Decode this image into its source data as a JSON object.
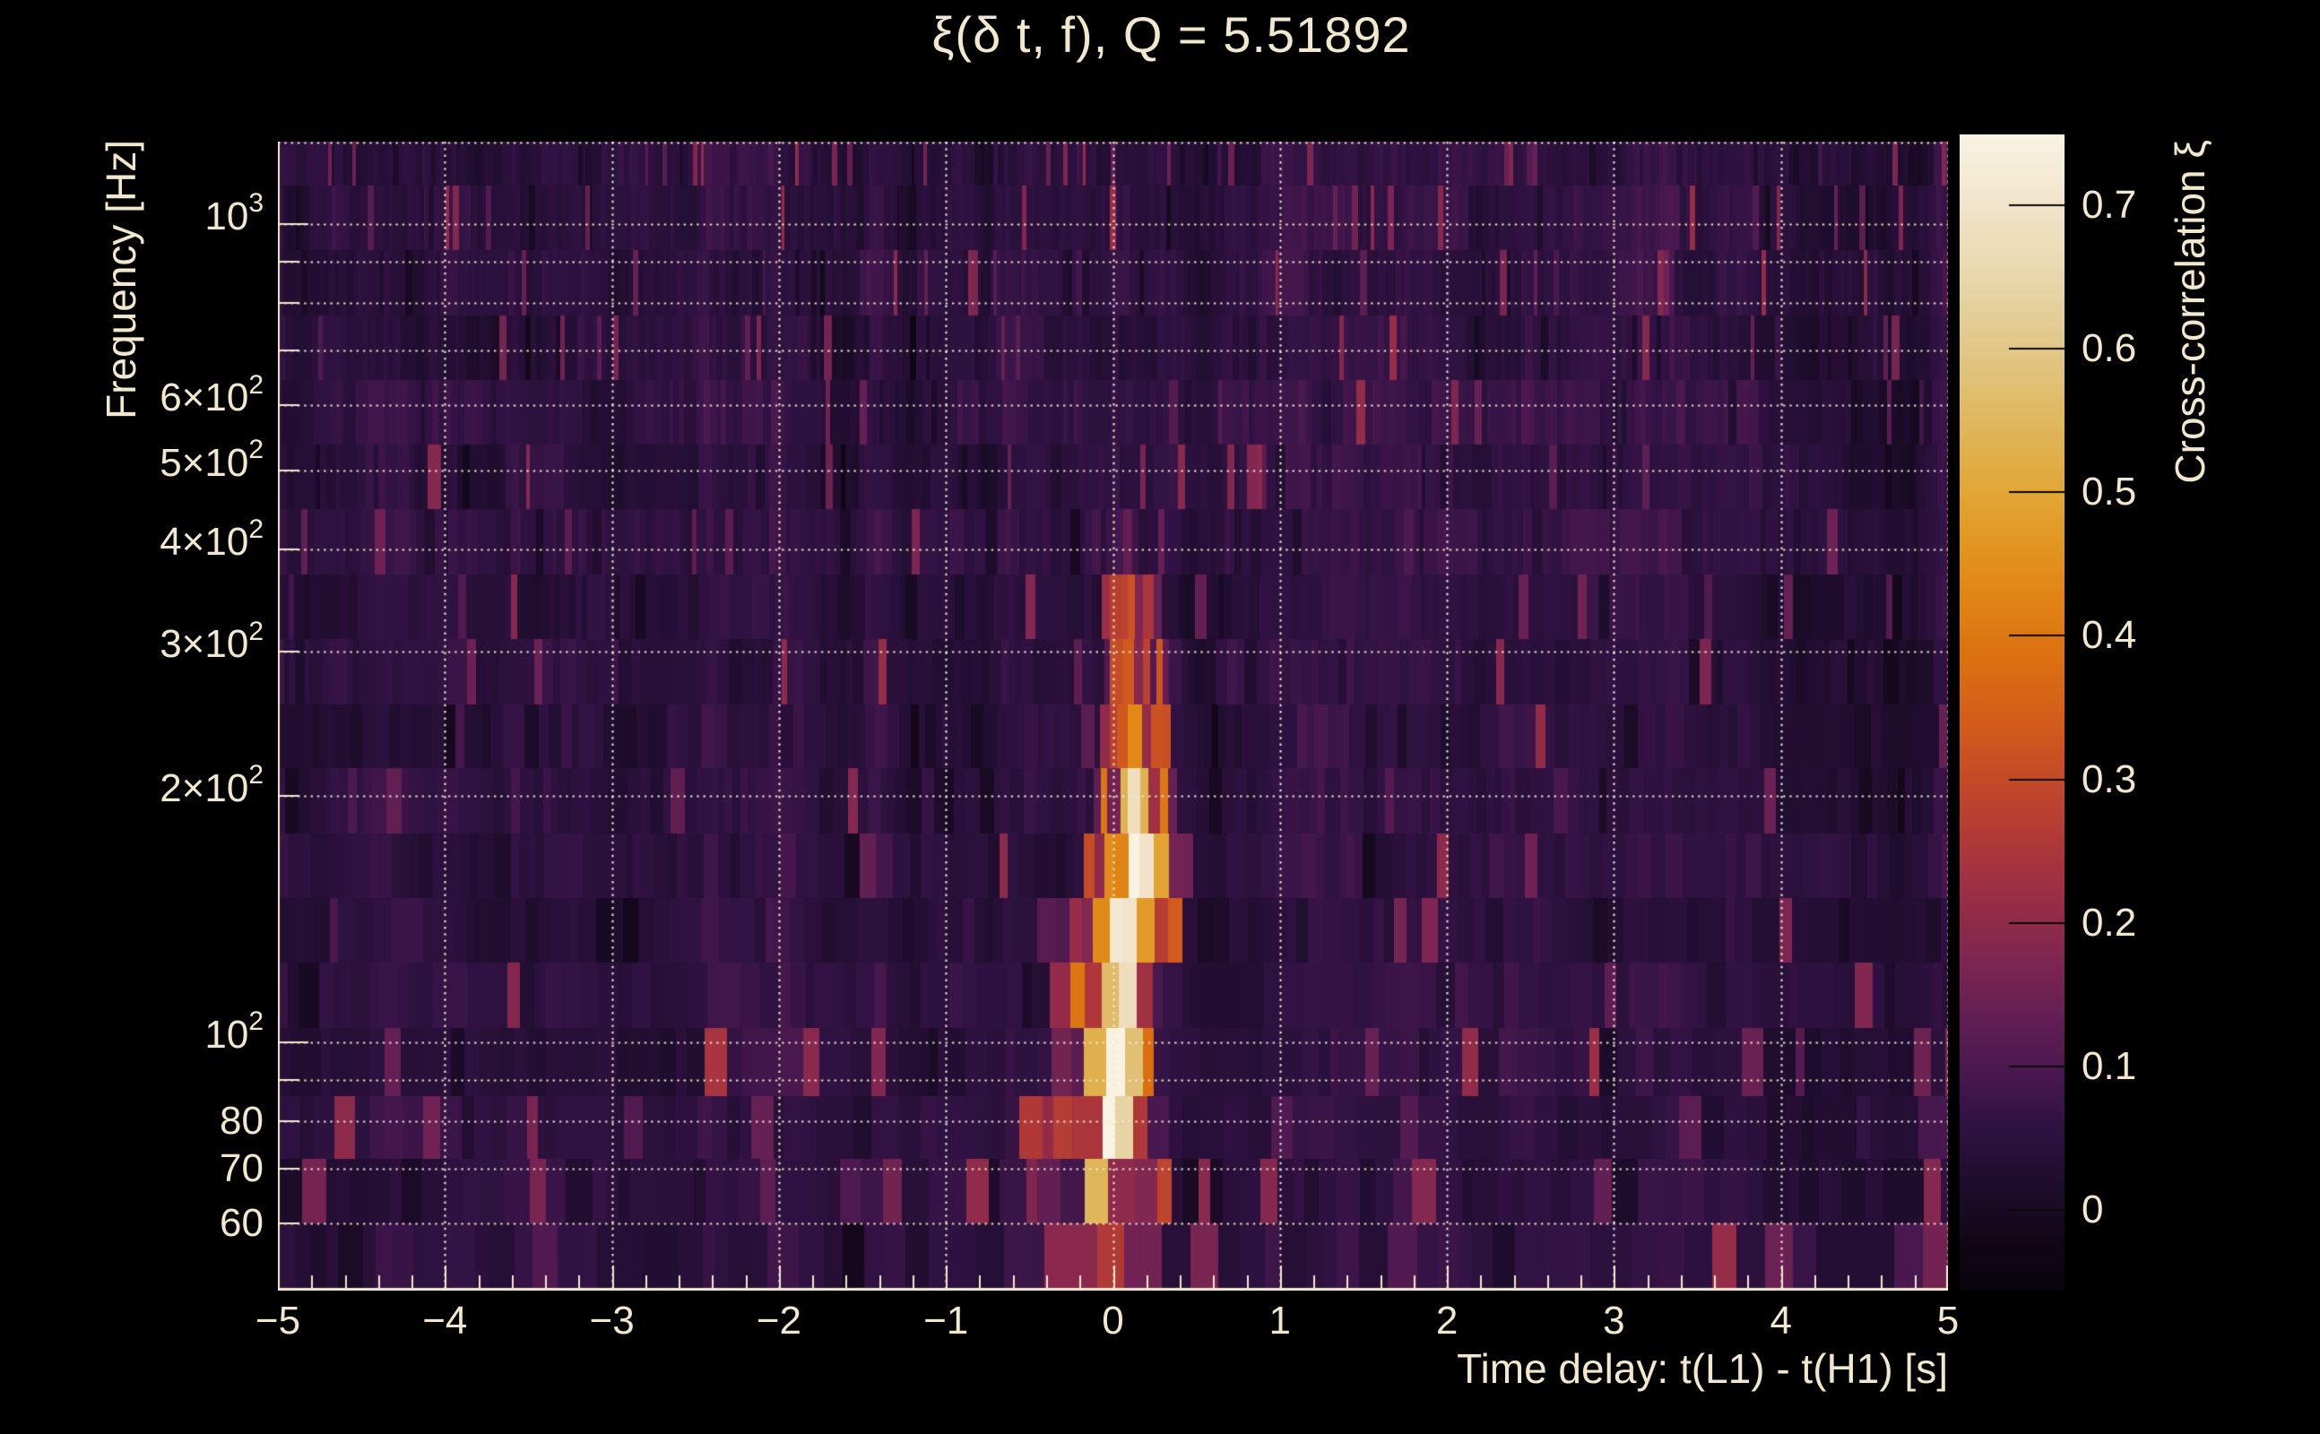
{
  "title": "ξ(δ t, f), Q = 5.51892",
  "colors": {
    "background": "#000000",
    "text": "#f2e8cd",
    "grid": "#f3ecd4",
    "axis_line": "#f2e8cd",
    "colorbar_tick": "#0a0a0a"
  },
  "chart_data": {
    "type": "heatmap",
    "title": "ξ(δ t, f), Q = 5.51892",
    "xlabel": "Time delay: t(L1) - t(H1) [s]",
    "ylabel": "Frequency [Hz]",
    "colorbar_label": "Cross-correlation ξ",
    "grid": true,
    "xlim": [
      -5,
      5
    ],
    "ylim": [
      49.7,
      1261
    ],
    "yscale": "log",
    "x_minor_step": 0.2,
    "x_ticks": [
      {
        "t": -5,
        "label": "−5"
      },
      {
        "t": -4,
        "label": "−4"
      },
      {
        "t": -3,
        "label": "−3"
      },
      {
        "t": -2,
        "label": "−2"
      },
      {
        "t": -1,
        "label": "−1"
      },
      {
        "t": 0,
        "label": "0"
      },
      {
        "t": 1,
        "label": "1"
      },
      {
        "t": 2,
        "label": "2"
      },
      {
        "t": 3,
        "label": "3"
      },
      {
        "t": 4,
        "label": "4"
      },
      {
        "t": 5,
        "label": "5"
      }
    ],
    "y_ticks": [
      {
        "f": 1000,
        "base": "10",
        "sup": "3"
      },
      {
        "f": 900
      },
      {
        "f": 800
      },
      {
        "f": 700
      },
      {
        "f": 600,
        "base": "6×10",
        "sup": "2"
      },
      {
        "f": 500,
        "base": "5×10",
        "sup": "2"
      },
      {
        "f": 400,
        "base": "4×10",
        "sup": "2"
      },
      {
        "f": 300,
        "base": "3×10",
        "sup": "2"
      },
      {
        "f": 200,
        "base": "2×10",
        "sup": "2"
      },
      {
        "f": 100,
        "base": "10",
        "sup": "2"
      },
      {
        "f": 90
      },
      {
        "f": 80,
        "base": "80"
      },
      {
        "f": 70,
        "base": "70"
      },
      {
        "f": 60,
        "base": "60"
      }
    ],
    "colorbar": {
      "vmin": -0.056,
      "vmax": 0.749,
      "ticks": [
        {
          "v": 0.7,
          "label": "0.7"
        },
        {
          "v": 0.6,
          "label": "0.6"
        },
        {
          "v": 0.5,
          "label": "0.5"
        },
        {
          "v": 0.4,
          "label": "0.4"
        },
        {
          "v": 0.3,
          "label": "0.3"
        },
        {
          "v": 0.2,
          "label": "0.2"
        },
        {
          "v": 0.1,
          "label": "0.1"
        },
        {
          "v": 0.0,
          "label": "0"
        }
      ],
      "colormap": [
        [
          -0.06,
          "#07030b"
        ],
        [
          -0.02,
          "#120717"
        ],
        [
          0.02,
          "#1f0d2e"
        ],
        [
          0.06,
          "#301242"
        ],
        [
          0.1,
          "#4c1950"
        ],
        [
          0.14,
          "#662054"
        ],
        [
          0.18,
          "#822750"
        ],
        [
          0.22,
          "#9b2e46"
        ],
        [
          0.26,
          "#b13a37"
        ],
        [
          0.3,
          "#c44a28"
        ],
        [
          0.34,
          "#d25c1b"
        ],
        [
          0.38,
          "#db6e12"
        ],
        [
          0.42,
          "#e08113"
        ],
        [
          0.46,
          "#e2941f"
        ],
        [
          0.5,
          "#e2a637"
        ],
        [
          0.54,
          "#dfb456"
        ],
        [
          0.58,
          "#dfc178"
        ],
        [
          0.62,
          "#e3cd96"
        ],
        [
          0.66,
          "#ead9b2"
        ],
        [
          0.7,
          "#f1e4cb"
        ],
        [
          0.75,
          "#f9f3e3"
        ]
      ]
    },
    "row_boundaries": [
      50,
      60,
      72,
      86,
      104,
      125,
      150,
      180,
      216,
      259,
      311,
      373,
      448,
      537,
      645,
      774,
      929,
      1115,
      1261
    ],
    "row_base": [
      0.05,
      0.048,
      0.052,
      0.046,
      0.05,
      0.044,
      0.046,
      0.05,
      0.044,
      0.048,
      0.042,
      0.05,
      0.046,
      0.052,
      0.044,
      0.048,
      0.05,
      0.046
    ],
    "peak": {
      "dt": 0.0,
      "f": 55,
      "xi": 0.75
    },
    "feature_segments": [
      {
        "f": [
          50,
          60
        ],
        "segs": [
          [
            -0.55,
            0.05,
            0.3
          ],
          [
            -0.28,
            0.06,
            0.5
          ],
          [
            -0.16,
            0.05,
            0.55
          ],
          [
            -0.03,
            0.05,
            0.77
          ],
          [
            0.06,
            0.04,
            0.45
          ],
          [
            0.17,
            0.05,
            0.32
          ],
          [
            0.28,
            0.05,
            0.26
          ],
          [
            0.0,
            0.45,
            0.12
          ]
        ]
      },
      {
        "f": [
          60,
          72
        ],
        "segs": [
          [
            -0.45,
            0.05,
            0.4
          ],
          [
            -0.33,
            0.05,
            0.44
          ],
          [
            -0.2,
            0.05,
            0.36
          ],
          [
            -0.07,
            0.07,
            0.65
          ],
          [
            0.04,
            0.05,
            0.5
          ],
          [
            0.14,
            0.05,
            0.34
          ],
          [
            0.0,
            0.45,
            0.12
          ]
        ]
      },
      {
        "f": [
          72,
          86
        ],
        "segs": [
          [
            -0.5,
            0.04,
            0.3
          ],
          [
            -0.34,
            0.06,
            0.42
          ],
          [
            -0.17,
            0.06,
            0.48
          ],
          [
            -0.04,
            0.06,
            0.62
          ],
          [
            0.08,
            0.06,
            0.46
          ],
          [
            0.2,
            0.05,
            0.3
          ],
          [
            0.0,
            0.45,
            0.12
          ]
        ]
      },
      {
        "f": [
          86,
          104
        ],
        "segs": [
          [
            -0.45,
            0.05,
            0.3
          ],
          [
            -0.3,
            0.05,
            0.36
          ],
          [
            -0.13,
            0.07,
            0.52
          ],
          [
            -0.01,
            0.07,
            0.66
          ],
          [
            0.11,
            0.06,
            0.48
          ],
          [
            0.23,
            0.05,
            0.3
          ],
          [
            0.0,
            0.45,
            0.13
          ]
        ]
      },
      {
        "f": [
          104,
          125
        ],
        "segs": [
          [
            -0.35,
            0.05,
            0.3
          ],
          [
            -0.2,
            0.06,
            0.36
          ],
          [
            -0.06,
            0.07,
            0.52
          ],
          [
            0.06,
            0.09,
            0.68
          ],
          [
            0.19,
            0.06,
            0.46
          ],
          [
            0.31,
            0.05,
            0.28
          ],
          [
            0.05,
            0.45,
            0.13
          ]
        ]
      },
      {
        "f": [
          125,
          150
        ],
        "segs": [
          [
            -0.25,
            0.05,
            0.28
          ],
          [
            -0.1,
            0.06,
            0.38
          ],
          [
            0.03,
            0.08,
            0.58
          ],
          [
            0.13,
            0.07,
            0.68
          ],
          [
            0.25,
            0.06,
            0.44
          ],
          [
            0.37,
            0.05,
            0.24
          ],
          [
            0.08,
            0.45,
            0.13
          ]
        ]
      },
      {
        "f": [
          150,
          180
        ],
        "segs": [
          [
            -0.12,
            0.05,
            0.28
          ],
          [
            0.0,
            0.06,
            0.4
          ],
          [
            0.1,
            0.07,
            0.58
          ],
          [
            0.19,
            0.06,
            0.58
          ],
          [
            0.29,
            0.06,
            0.38
          ],
          [
            0.42,
            0.05,
            0.22
          ],
          [
            0.1,
            0.4,
            0.12
          ]
        ]
      },
      {
        "f": [
          180,
          216
        ],
        "segs": [
          [
            -0.05,
            0.05,
            0.25
          ],
          [
            0.04,
            0.06,
            0.36
          ],
          [
            0.13,
            0.06,
            0.52
          ],
          [
            0.22,
            0.06,
            0.48
          ],
          [
            0.31,
            0.05,
            0.33
          ],
          [
            0.1,
            0.4,
            0.11
          ]
        ]
      },
      {
        "f": [
          216,
          259
        ],
        "segs": [
          [
            0.02,
            0.05,
            0.26
          ],
          [
            0.12,
            0.06,
            0.44
          ],
          [
            0.22,
            0.06,
            0.4
          ],
          [
            0.32,
            0.05,
            0.27
          ],
          [
            0.12,
            0.35,
            0.1
          ]
        ]
      },
      {
        "f": [
          259,
          311
        ],
        "segs": [
          [
            0.03,
            0.06,
            0.24
          ],
          [
            0.14,
            0.07,
            0.34
          ],
          [
            0.26,
            0.06,
            0.26
          ],
          [
            0.12,
            0.35,
            0.09
          ]
        ]
      },
      {
        "f": [
          311,
          373
        ],
        "segs": [
          [
            -0.02,
            0.07,
            0.18
          ],
          [
            0.1,
            0.08,
            0.24
          ],
          [
            0.23,
            0.06,
            0.18
          ],
          [
            0.1,
            0.3,
            0.08
          ]
        ]
      },
      {
        "f": [
          373,
          448
        ],
        "segs": [
          [
            -0.1,
            0.12,
            0.1
          ],
          [
            0.07,
            0.1,
            0.12
          ]
        ]
      }
    ],
    "speckles": [
      [
        -4.33,
        50,
        104,
        0.13,
        0.05
      ],
      [
        -3.8,
        50,
        72,
        0.12,
        0.04
      ],
      [
        -2.15,
        50,
        86,
        0.12,
        0.04
      ],
      [
        -0.9,
        104,
        150,
        0.15,
        0.05
      ],
      [
        0.32,
        50,
        104,
        0.3,
        0.035
      ],
      [
        0.55,
        50,
        86,
        0.2,
        0.045
      ],
      [
        1.0,
        50,
        125,
        0.17,
        0.04
      ],
      [
        1.75,
        50,
        72,
        0.12,
        0.04
      ],
      [
        3.66,
        50,
        86,
        0.2,
        0.04
      ],
      [
        4.92,
        50,
        86,
        0.26,
        0.045
      ],
      [
        0.9,
        448,
        700,
        0.1,
        0.08
      ]
    ]
  }
}
